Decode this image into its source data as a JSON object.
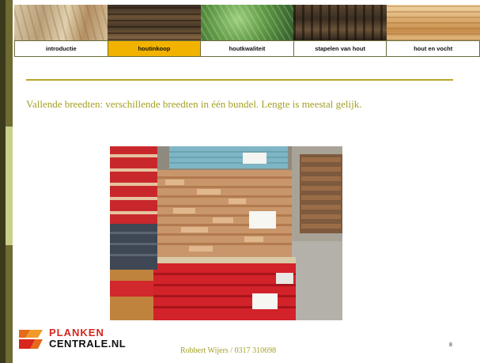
{
  "nav": {
    "items": [
      {
        "label": "introductie",
        "active": false
      },
      {
        "label": "houtinkoop",
        "active": true
      },
      {
        "label": "houtkwaliteit",
        "active": false
      },
      {
        "label": "stapelen van hout",
        "active": false
      },
      {
        "label": "hout en vocht",
        "active": false
      }
    ]
  },
  "slide": {
    "text": "Vallende breedten: verschillende breedten in één bundel. Lengte is meestal gelijk."
  },
  "logo": {
    "line1": "PLANKEN",
    "line2": "CENTRALE.NL"
  },
  "footer": {
    "text": "Robbert Wijers / 0317 310698",
    "page_number": "8"
  },
  "colors": {
    "accent": "#f2b300",
    "text": "#a4a023",
    "divider": "#b8a62a",
    "logo_red": "#d7261e"
  }
}
